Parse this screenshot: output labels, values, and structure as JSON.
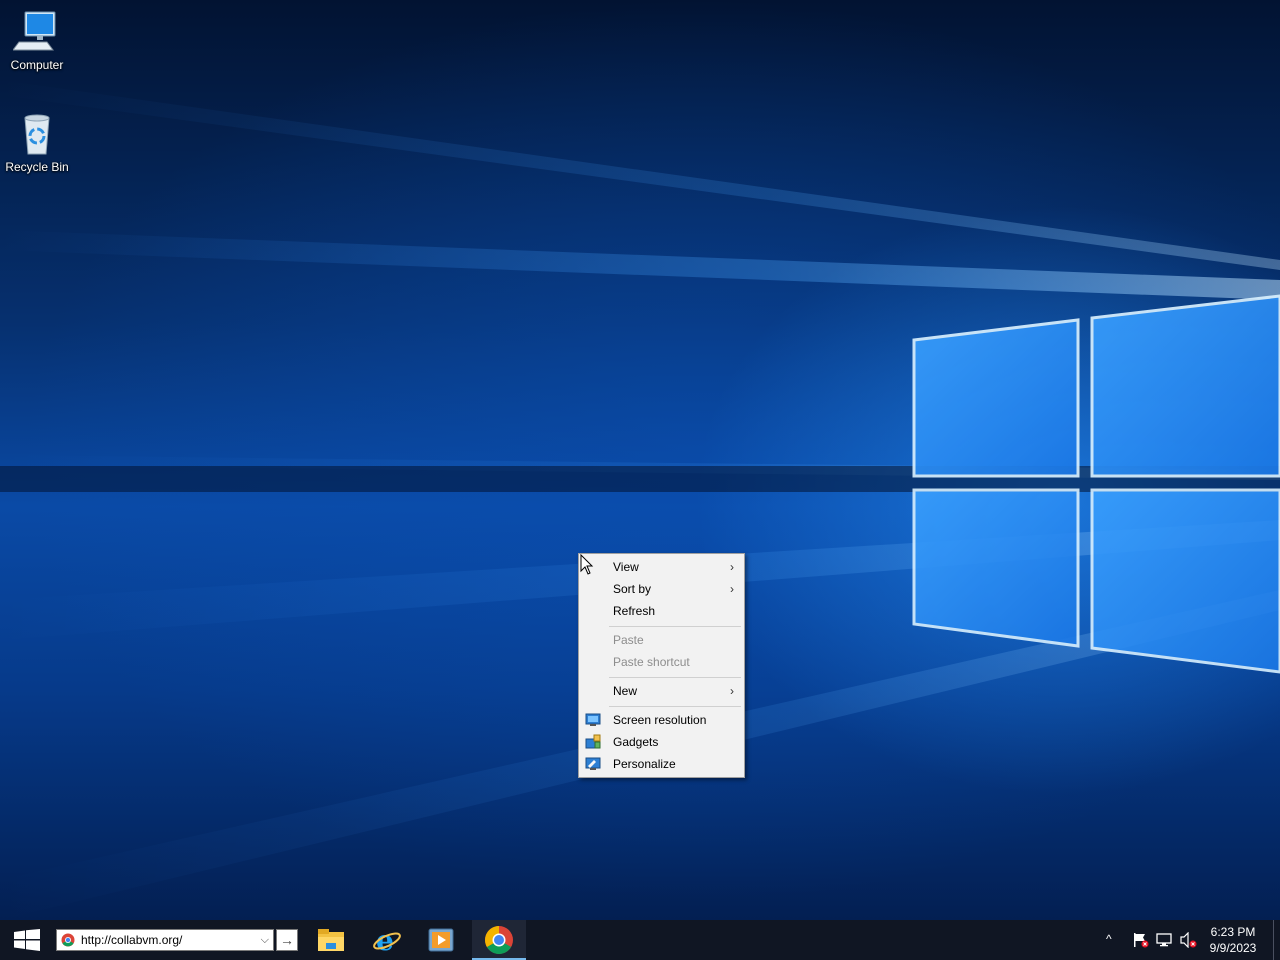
{
  "desktop": {
    "icons": [
      {
        "label": "Computer",
        "icon": "computer-icon"
      },
      {
        "label": "Recycle Bin",
        "icon": "recycle-bin-icon"
      }
    ]
  },
  "context_menu": {
    "items": [
      {
        "label": "View",
        "submenu": true,
        "enabled": true
      },
      {
        "label": "Sort by",
        "submenu": true,
        "enabled": true
      },
      {
        "label": "Refresh",
        "submenu": false,
        "enabled": true
      },
      {
        "label": "Paste",
        "submenu": false,
        "enabled": false
      },
      {
        "label": "Paste shortcut",
        "submenu": false,
        "enabled": false
      },
      {
        "label": "New",
        "submenu": true,
        "enabled": true
      },
      {
        "label": "Screen resolution",
        "submenu": false,
        "enabled": true,
        "icon": "screen-resolution-icon"
      },
      {
        "label": "Gadgets",
        "submenu": false,
        "enabled": true,
        "icon": "gadgets-icon"
      },
      {
        "label": "Personalize",
        "submenu": false,
        "enabled": true,
        "icon": "personalize-icon"
      }
    ],
    "submenu_glyph": "›"
  },
  "taskbar": {
    "start_icon": "windows-logo-icon",
    "address_bar": {
      "url": "http://collabvm.org/",
      "dropdown_glyph": "⌵"
    },
    "go_glyph": "→",
    "apps": [
      {
        "name": "File Explorer",
        "icon": "file-explorer-icon",
        "active": false
      },
      {
        "name": "Internet Explorer",
        "icon": "internet-explorer-icon",
        "active": false
      },
      {
        "name": "Windows Media Player",
        "icon": "media-player-icon",
        "active": false
      },
      {
        "name": "Google Chrome",
        "icon": "chrome-icon",
        "active": true
      }
    ],
    "tray": {
      "chevron": "^",
      "icons": [
        "action-center-flag-icon",
        "network-icon",
        "volume-muted-icon"
      ]
    },
    "clock": {
      "time": "6:23 PM",
      "date": "9/9/2023"
    }
  },
  "colors": {
    "taskbar_bg": "#101623",
    "menu_bg": "#f2f2f2",
    "active_app_underline": "#76b9ed"
  }
}
